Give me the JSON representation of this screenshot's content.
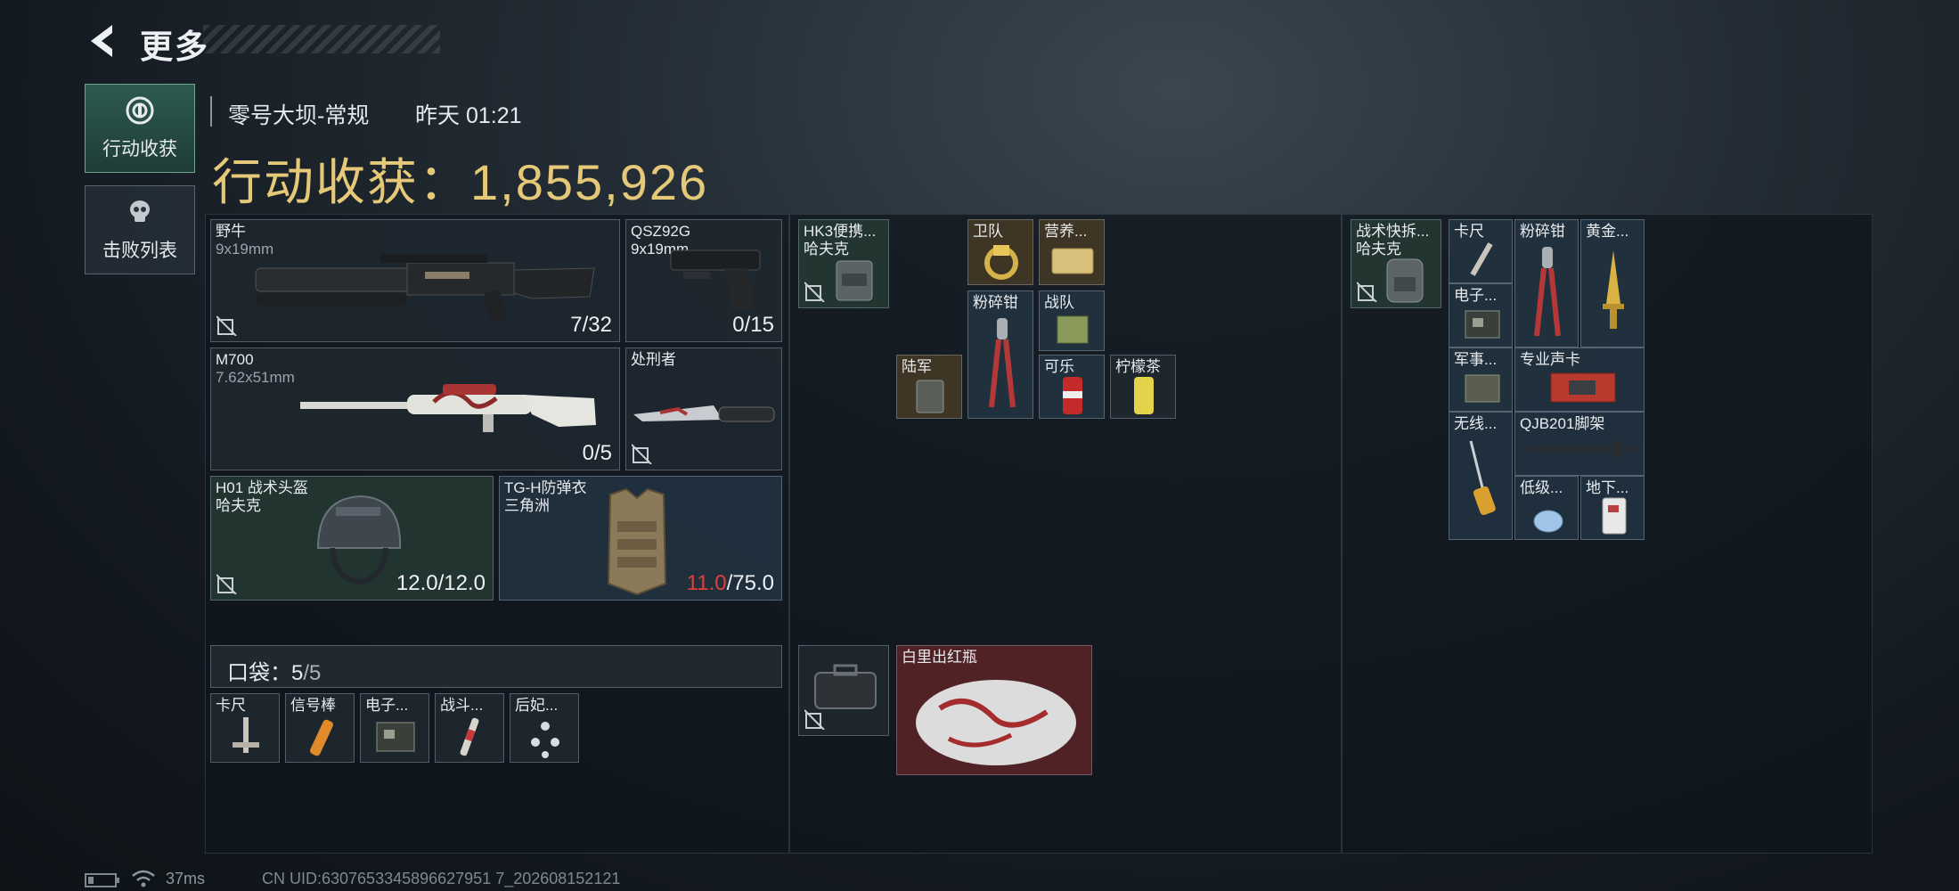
{
  "header": {
    "title": "更多"
  },
  "side_tabs": [
    {
      "label": "行动收获",
      "active": true,
      "icon": "target-icon"
    },
    {
      "label": "击败列表",
      "active": false,
      "icon": "skull-icon"
    }
  ],
  "match": {
    "map": "零号大坝-常规",
    "time": "昨天 01:21"
  },
  "haul": {
    "label": "行动收获：",
    "value": "1,855,926"
  },
  "gear": {
    "primary": {
      "name": "野牛",
      "ammo": "9x19mm",
      "count": "7/32"
    },
    "sidearm": {
      "name": "QSZ92G",
      "ammo": "9x19mm",
      "count": "0/15"
    },
    "secondary": {
      "name": "M700",
      "ammo": "7.62x51mm",
      "count": "0/5"
    },
    "melee": {
      "name": "处刑者"
    },
    "helmet": {
      "name": "H01 战术头盔",
      "brand": "哈夫克",
      "cur": "12.0",
      "max": "/12.0"
    },
    "armor": {
      "name": "TG-H防弹衣",
      "brand": "三角洲",
      "cur": "11.0",
      "max": "/75.0"
    }
  },
  "pocket": {
    "label": "口袋：",
    "used": "5",
    "capacity": "/5",
    "items": [
      "卡尺",
      "信号棒",
      "电子...",
      "战斗...",
      "后妃..."
    ]
  },
  "chest_rig": {
    "name": "HK3便携...",
    "brand": "哈夫克"
  },
  "rig_items": [
    "卫队",
    "营养...",
    "粉碎钳",
    "战队",
    "陆军",
    "可乐",
    "柠檬茶"
  ],
  "case": {
    "item": "白里出红瓶"
  },
  "backpack": {
    "name": "战术快拆...",
    "brand": "哈夫克"
  },
  "backpack_items": [
    "卡尺",
    "粉碎钳",
    "黄金...",
    "电子...",
    "军事...",
    "专业声卡",
    "无线...",
    "QJB201脚架",
    "低级...",
    "地下..."
  ],
  "status": {
    "ping": "37ms",
    "uid": "CN UID:6307653345896627951 7_202608152121"
  },
  "colors": {
    "gold": "#e5c878",
    "accent_green": "#6fa48d",
    "danger": "#e0403b"
  }
}
